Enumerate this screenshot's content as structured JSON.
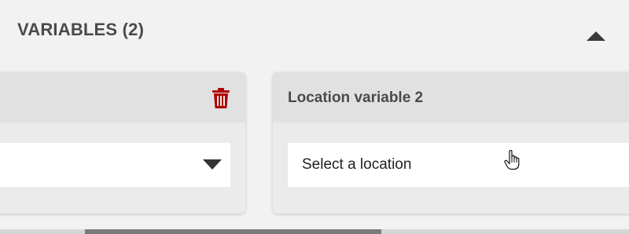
{
  "variables_section": {
    "title": "VARIABLES (2)",
    "collapse_icon": "caret-up-icon"
  },
  "cards": [
    {
      "title": "",
      "delete_icon": "trash-icon",
      "delete_icon_color": "#b00000",
      "select_value": "",
      "dropdown_icon": "caret-down-icon"
    },
    {
      "title": "Location variable 2",
      "select_placeholder": "Select a location"
    }
  ],
  "pointer_icon": "hand-pointer-icon",
  "scrollbar": {
    "position_fraction": 0.14
  },
  "colors": {
    "background": "#f2f2f2",
    "card_header": "#e1e1e1",
    "card_body": "#ebebeb",
    "danger": "#b00000",
    "text": "#4a4a4a"
  }
}
